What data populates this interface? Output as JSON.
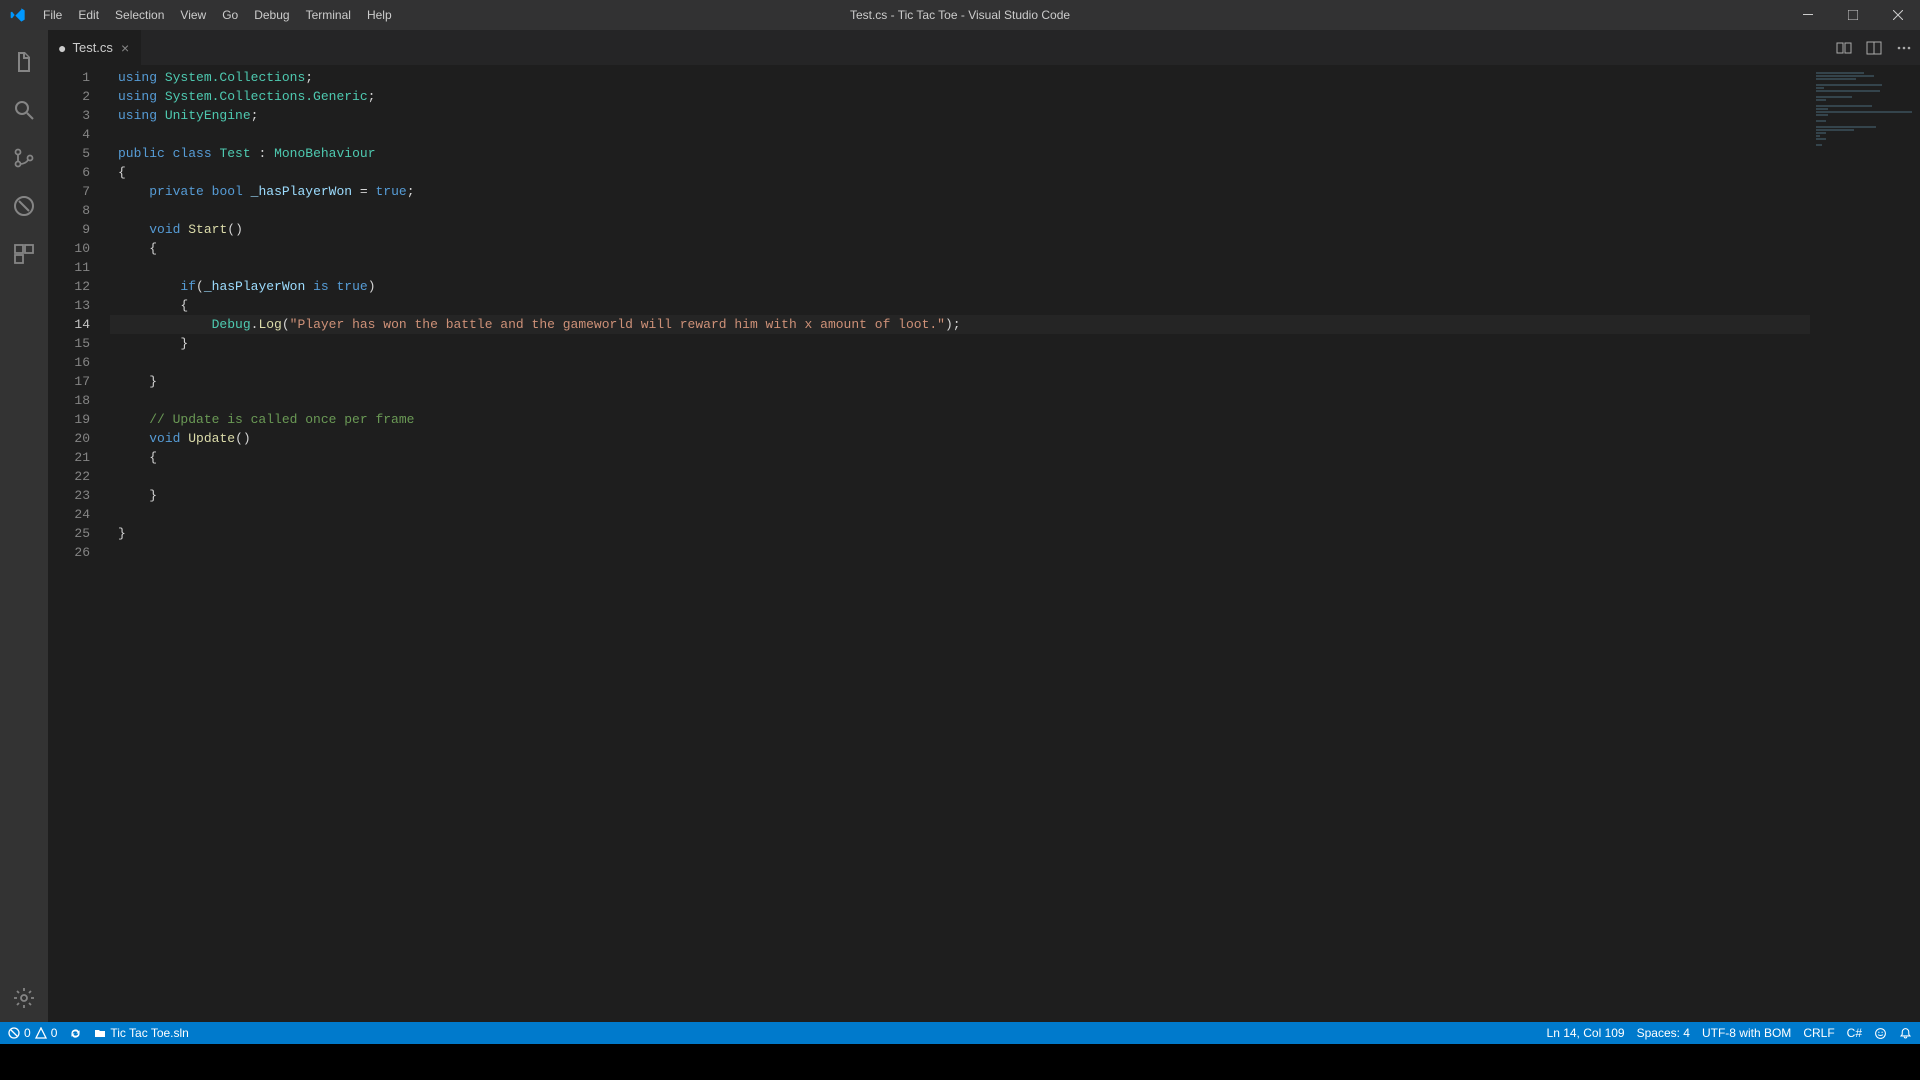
{
  "window": {
    "title": "Test.cs - Tic Tac Toe - Visual Studio Code"
  },
  "menu": [
    "File",
    "Edit",
    "Selection",
    "View",
    "Go",
    "Debug",
    "Terminal",
    "Help"
  ],
  "tab": {
    "name": "Test.cs",
    "dirty": "●"
  },
  "code": {
    "lines": [
      [
        {
          "t": "kw",
          "v": "using"
        },
        {
          "t": "pln",
          "v": " "
        },
        {
          "t": "cls",
          "v": "System.Collections"
        },
        {
          "t": "pln",
          "v": ";"
        }
      ],
      [
        {
          "t": "kw",
          "v": "using"
        },
        {
          "t": "pln",
          "v": " "
        },
        {
          "t": "cls",
          "v": "System.Collections.Generic"
        },
        {
          "t": "pln",
          "v": ";"
        }
      ],
      [
        {
          "t": "kw",
          "v": "using"
        },
        {
          "t": "pln",
          "v": " "
        },
        {
          "t": "cls",
          "v": "UnityEngine"
        },
        {
          "t": "pln",
          "v": ";"
        }
      ],
      [
        {
          "t": "pln",
          "v": ""
        }
      ],
      [
        {
          "t": "kw",
          "v": "public"
        },
        {
          "t": "pln",
          "v": " "
        },
        {
          "t": "kw",
          "v": "class"
        },
        {
          "t": "pln",
          "v": " "
        },
        {
          "t": "cls",
          "v": "Test"
        },
        {
          "t": "pln",
          "v": " : "
        },
        {
          "t": "cls",
          "v": "MonoBehaviour"
        }
      ],
      [
        {
          "t": "pln",
          "v": "{"
        }
      ],
      [
        {
          "t": "pln",
          "v": "    "
        },
        {
          "t": "kw",
          "v": "private"
        },
        {
          "t": "pln",
          "v": " "
        },
        {
          "t": "kw",
          "v": "bool"
        },
        {
          "t": "pln",
          "v": " "
        },
        {
          "t": "var",
          "v": "_hasPlayerWon"
        },
        {
          "t": "pln",
          "v": " = "
        },
        {
          "t": "kw",
          "v": "true"
        },
        {
          "t": "pln",
          "v": ";"
        }
      ],
      [
        {
          "t": "pln",
          "v": ""
        }
      ],
      [
        {
          "t": "pln",
          "v": "    "
        },
        {
          "t": "kw",
          "v": "void"
        },
        {
          "t": "pln",
          "v": " "
        },
        {
          "t": "fn",
          "v": "Start"
        },
        {
          "t": "pln",
          "v": "()"
        }
      ],
      [
        {
          "t": "pln",
          "v": "    {"
        }
      ],
      [
        {
          "t": "pln",
          "v": ""
        }
      ],
      [
        {
          "t": "pln",
          "v": "        "
        },
        {
          "t": "kw",
          "v": "if"
        },
        {
          "t": "pln",
          "v": "("
        },
        {
          "t": "var",
          "v": "_hasPlayerWon"
        },
        {
          "t": "pln",
          "v": " "
        },
        {
          "t": "kw",
          "v": "is"
        },
        {
          "t": "pln",
          "v": " "
        },
        {
          "t": "kw",
          "v": "true"
        },
        {
          "t": "pln",
          "v": ")"
        }
      ],
      [
        {
          "t": "pln",
          "v": "        {"
        }
      ],
      [
        {
          "t": "pln",
          "v": "            "
        },
        {
          "t": "cls",
          "v": "Debug"
        },
        {
          "t": "pln",
          "v": "."
        },
        {
          "t": "fn",
          "v": "Log"
        },
        {
          "t": "pln",
          "v": "("
        },
        {
          "t": "str",
          "v": "\"Player has won the battle and the gameworld will reward him with x amount of loot.\""
        },
        {
          "t": "pln",
          "v": ");"
        }
      ],
      [
        {
          "t": "pln",
          "v": "        }"
        }
      ],
      [
        {
          "t": "pln",
          "v": ""
        }
      ],
      [
        {
          "t": "pln",
          "v": "    }"
        }
      ],
      [
        {
          "t": "pln",
          "v": ""
        }
      ],
      [
        {
          "t": "pln",
          "v": "    "
        },
        {
          "t": "com",
          "v": "// Update is called once per frame"
        }
      ],
      [
        {
          "t": "pln",
          "v": "    "
        },
        {
          "t": "kw",
          "v": "void"
        },
        {
          "t": "pln",
          "v": " "
        },
        {
          "t": "fn",
          "v": "Update"
        },
        {
          "t": "pln",
          "v": "()"
        }
      ],
      [
        {
          "t": "pln",
          "v": "    {"
        }
      ],
      [
        {
          "t": "pln",
          "v": "        "
        }
      ],
      [
        {
          "t": "pln",
          "v": "    }"
        }
      ],
      [
        {
          "t": "pln",
          "v": ""
        }
      ],
      [
        {
          "t": "pln",
          "v": "}"
        }
      ],
      [
        {
          "t": "pln",
          "v": ""
        }
      ]
    ],
    "currentLine": 14
  },
  "status": {
    "errors": "0",
    "warnings": "0",
    "solution": "Tic Tac Toe.sln",
    "cursor": "Ln 14, Col 109",
    "spaces": "Spaces: 4",
    "encoding": "UTF-8 with BOM",
    "eol": "CRLF",
    "language": "C#"
  }
}
